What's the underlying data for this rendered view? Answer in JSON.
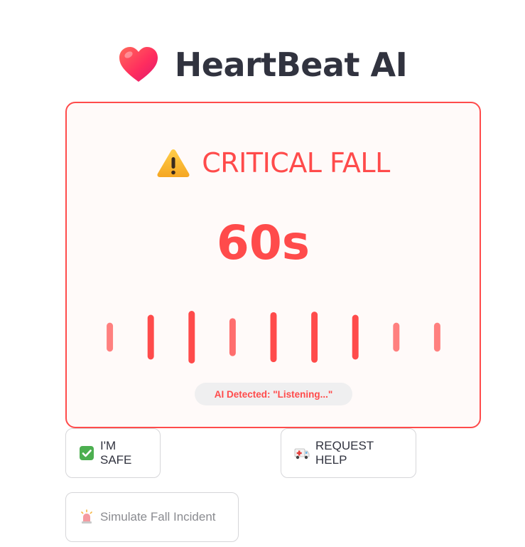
{
  "header": {
    "title": "HeartBeat AI",
    "icon": "heart-icon"
  },
  "alert": {
    "title": "CRITICAL FALL",
    "icon": "warning-icon",
    "countdown": "60s",
    "ai_status": "AI Detected: \"Listening...\"",
    "waveform_levels": [
      0.55,
      0.85,
      1.0,
      0.72,
      0.95,
      0.97,
      0.85,
      0.55,
      0.55
    ],
    "waveform_opacity": [
      0.7,
      1.0,
      1.0,
      0.8,
      1.0,
      1.0,
      1.0,
      0.7,
      0.7
    ]
  },
  "actions": {
    "safe_label": "I'M SAFE",
    "safe_icon": "check-mark-icon",
    "help_label": "REQUEST HELP",
    "help_icon": "ambulance-icon",
    "simulate_label": "Simulate Fall Incident",
    "simulate_icon": "siren-icon"
  },
  "colors": {
    "accent": "#ff4b4b",
    "text": "#31333f",
    "muted": "#8a8b90",
    "card_bg": "#fffaf9",
    "pill_bg": "#efeff0"
  }
}
